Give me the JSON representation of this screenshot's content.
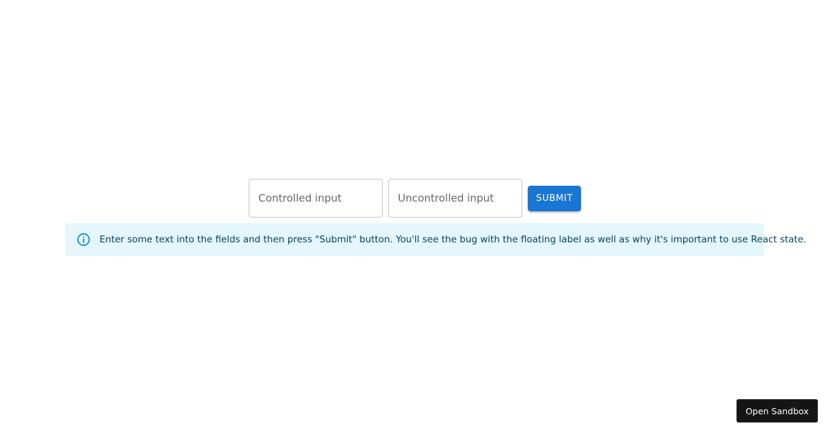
{
  "form": {
    "controlled_input": {
      "placeholder": "Controlled input",
      "value": ""
    },
    "uncontrolled_input": {
      "placeholder": "Uncontrolled input",
      "value": ""
    },
    "submit_label": "Submit"
  },
  "alert": {
    "icon": "info-icon",
    "message": "Enter some text into the fields and then press \"Submit\" button. You'll see the bug with the floating label as well as why it's important to use React state."
  },
  "sandbox_button": {
    "label": "Open Sandbox"
  },
  "colors": {
    "primary": "#1976d2",
    "alert_background": "#e5f6fd",
    "alert_text": "#014361",
    "info_icon": "#0288d1",
    "sandbox_background": "#151515"
  }
}
